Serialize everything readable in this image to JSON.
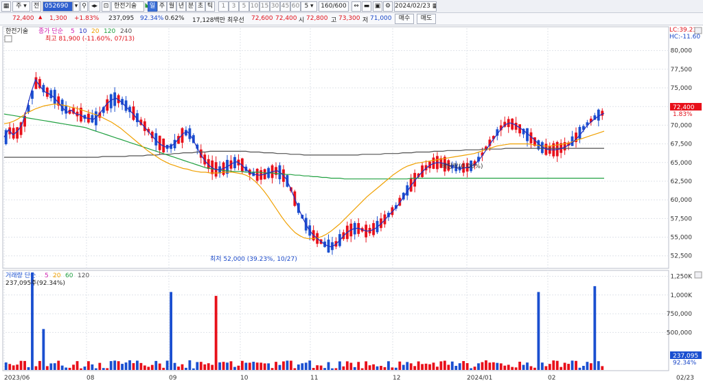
{
  "toolbar": {
    "code": "052690",
    "stock_name": "한전기술",
    "period_buttons": [
      "일",
      "주",
      "월",
      "년",
      "분",
      "초",
      "틱"
    ],
    "period_selected": "일",
    "number_buttons": [
      "1",
      "3",
      "5",
      "10",
      "15",
      "30",
      "45",
      "60"
    ],
    "count_select": "5",
    "bar_count": "160/600",
    "date": "2024/02/23",
    "menu_label": "주",
    "jeon_label": "전"
  },
  "quote": {
    "price": "72,400",
    "change": "1,300",
    "change_pct": "+1.83%",
    "volume": "237,095",
    "volume_ratio": "92.34%",
    "turnover_rate": "0.62%",
    "trade_value": "17,128백만",
    "best_ask_label": "최우선",
    "best_ask": "72,600",
    "best_bid": "72,400",
    "open_label": "시",
    "open": "72,800",
    "high_label": "고",
    "high": "73,300",
    "low_label": "저",
    "low": "71,000",
    "buy_button": "매수",
    "sell_button": "매도"
  },
  "colors": {
    "up": "#e8101a",
    "down": "#1a4fd0",
    "ma5": "#d020b0",
    "ma10": "#2030c0",
    "ma20": "#f0a000",
    "ma60": "#20a040",
    "ma120": "#505050",
    "grid": "#dfe3ea"
  },
  "price_panel": {
    "legend_name": "한전기술",
    "legend_label": "종가 단순",
    "legend_periods": [
      "5",
      "10",
      "20",
      "120",
      "240"
    ],
    "high_annotation": "최고 81,900 (-11.60%, 07/13)",
    "low_annotation": "최저 52,000 (39.23%, 10/27)",
    "event_annotation": "배당락(0.00%)",
    "lc_label": "LC:39.23",
    "hc_label": "HC:-11.60",
    "current_price_tag": "72,400",
    "current_change_tag": "1.83%"
  },
  "volume_panel": {
    "legend_label": "거래량 단순",
    "legend_periods": [
      "5",
      "20",
      "60",
      "120"
    ],
    "summary": "237,095주(92.34%)",
    "current_volume_tag": "237,095",
    "current_ratio_tag": "92.34%"
  },
  "chart_data": {
    "type": "candlestick",
    "price_axis_ticks": [
      "80,000",
      "77,500",
      "75,000",
      "72,500",
      "70,000",
      "67,500",
      "65,000",
      "62,500",
      "60,000",
      "57,500",
      "55,000",
      "52,500"
    ],
    "price_axis_values": [
      80000,
      77500,
      75000,
      72500,
      70000,
      67500,
      65000,
      62500,
      60000,
      57500,
      55000,
      52500
    ],
    "price_range": [
      51000,
      83000
    ],
    "volume_axis_ticks": [
      "1,250K",
      "1,000K",
      "750,000",
      "500,000"
    ],
    "volume_axis_values": [
      1250000,
      1000000,
      750000,
      500000
    ],
    "volume_range": [
      0,
      1300000
    ],
    "x_axis_labels": [
      "2023/06",
      "08",
      "09",
      "10",
      "11",
      "12",
      "2024/01",
      "02",
      "02/23"
    ],
    "x_axis_label_index": [
      0,
      41,
      80,
      117,
      150,
      189,
      227,
      264,
      159
    ],
    "ma5": [
      68400,
      69400,
      68700,
      69200,
      70100,
      72100,
      74300,
      76100,
      75200,
      74500,
      74200,
      73800,
      73100,
      72400,
      71700,
      72000,
      71500,
      71400,
      71000,
      70900,
      70800,
      71300,
      72100,
      72900,
      73400,
      73600,
      73200,
      72600,
      72000,
      71400,
      70600,
      70000,
      69300,
      68600,
      67900,
      67400,
      67100,
      67100,
      67500,
      68200,
      68900,
      69100,
      68300,
      67100,
      66000,
      65100,
      64500,
      64100,
      64000,
      64200,
      64500,
      64900,
      65100,
      64700,
      64100,
      63600,
      63400,
      63300,
      63400,
      63600,
      63800,
      63900,
      63500,
      62800,
      61500,
      60000,
      58500,
      57200,
      56100,
      55300,
      54800,
      54300,
      53900,
      53700,
      54000,
      54600,
      55300,
      55800,
      56100,
      56200,
      56000,
      55800,
      55900,
      56200,
      56700,
      57300,
      58000,
      58600,
      59300,
      60200,
      61100,
      62000,
      62800,
      63500,
      64100,
      64600,
      64900,
      65000,
      64900,
      64700,
      64500,
      64300,
      64200,
      64300,
      64400,
      64700,
      65300,
      66100,
      67000,
      67900,
      68700,
      69500,
      70100,
      70300,
      70100,
      69700,
      69300,
      68800,
      68300,
      67700,
      67200,
      66800,
      66700,
      66700,
      66800,
      67000,
      67300,
      67700,
      68300,
      69000,
      69800,
      70400,
      70900,
      71300,
      71600
    ],
    "ma20": [
      70200,
      70300,
      70500,
      70800,
      71200,
      71600,
      71900,
      72200,
      72400,
      72600,
      72700,
      72800,
      72800,
      72700,
      72600,
      72400,
      72300,
      72100,
      71900,
      71700,
      71500,
      71300,
      71000,
      70700,
      70400,
      70000,
      69600,
      69100,
      68600,
      68100,
      67600,
      67100,
      66600,
      66200,
      65800,
      65400,
      65100,
      64800,
      64600,
      64400,
      64200,
      64100,
      63900,
      63800,
      63700,
      63700,
      63600,
      63600,
      63600,
      63700,
      63700,
      63700,
      63600,
      63500,
      63300,
      63000,
      62500,
      61900,
      61200,
      60400,
      59500,
      58600,
      57700,
      56900,
      56200,
      55600,
      55200,
      54900,
      54800,
      54800,
      54900,
      55100,
      55400,
      55800,
      56300,
      56800,
      57400,
      58000,
      58600,
      59200,
      59800,
      60400,
      60900,
      61400,
      61900,
      62400,
      62900,
      63400,
      63800,
      64200,
      64500,
      64700,
      64900,
      65000,
      65100,
      65200,
      65300,
      65400,
      65500,
      65600,
      65700,
      65800,
      65900,
      66000,
      66100,
      66200,
      66400,
      66600,
      66800,
      67000,
      67200,
      67300,
      67400,
      67500,
      67500,
      67500,
      67500,
      67500,
      67400,
      67300,
      67200,
      67200,
      67200,
      67300,
      67400,
      67500,
      67600,
      67800,
      68000,
      68200,
      68400,
      68600,
      68800,
      69000,
      69200
    ],
    "ma60": [
      71500,
      71400,
      71300,
      71200,
      71100,
      71000,
      70900,
      70800,
      70700,
      70600,
      70500,
      70400,
      70300,
      70200,
      70100,
      70000,
      69900,
      69800,
      69700,
      69500,
      69300,
      69100,
      68900,
      68700,
      68500,
      68300,
      68100,
      67900,
      67700,
      67500,
      67300,
      67100,
      66900,
      66700,
      66500,
      66300,
      66100,
      65900,
      65700,
      65500,
      65300,
      65100,
      64900,
      64700,
      64500,
      64300,
      64200,
      64100,
      64000,
      63900,
      63900,
      63800,
      63800,
      63800,
      63700,
      63700,
      63700,
      63700,
      63600,
      63600,
      63600,
      63500,
      63500,
      63400,
      63400,
      63300,
      63300,
      63200,
      63200,
      63100,
      63100,
      63000,
      63000,
      62900,
      62900,
      62900,
      62800,
      62800,
      62800,
      62800,
      62800,
      62800,
      62800,
      62800,
      62800,
      62800,
      62800,
      62800,
      62800,
      62800,
      62800,
      62900,
      62900,
      62900,
      62900,
      62900,
      62900,
      62900,
      62900,
      62900,
      62900,
      62900,
      62900,
      62900,
      62900,
      62900,
      62900,
      62900,
      62900,
      62900,
      62900,
      62900,
      62900,
      62900,
      62900,
      62900,
      62900,
      62900,
      62900,
      62900,
      62900,
      62900,
      62900,
      62900,
      62900,
      62900,
      62900,
      62900,
      62900,
      62900,
      62900,
      62900,
      62900,
      62900,
      62900
    ],
    "ma120": [
      65700,
      65700,
      65700,
      65700,
      65700,
      65700,
      65700,
      65700,
      65700,
      65700,
      65700,
      65700,
      65700,
      65700,
      65700,
      65700,
      65700,
      65700,
      65700,
      65700,
      65700,
      65700,
      65800,
      65800,
      65800,
      65800,
      65800,
      65800,
      65900,
      65900,
      65900,
      65900,
      66000,
      66000,
      66000,
      66100,
      66100,
      66100,
      66200,
      66200,
      66300,
      66300,
      66300,
      66400,
      66400,
      66400,
      66500,
      66500,
      66500,
      66500,
      66500,
      66500,
      66500,
      66500,
      66500,
      66400,
      66400,
      66400,
      66300,
      66300,
      66300,
      66200,
      66200,
      66200,
      66100,
      66100,
      66100,
      66000,
      66000,
      66000,
      66000,
      66000,
      66000,
      66000,
      66000,
      66000,
      66000,
      66000,
      66000,
      66000,
      66100,
      66100,
      66100,
      66100,
      66100,
      66200,
      66200,
      66200,
      66200,
      66300,
      66300,
      66300,
      66400,
      66400,
      66400,
      66400,
      66500,
      66500,
      66500,
      66600,
      66600,
      66600,
      66600,
      66700,
      66700,
      66700,
      66700,
      66800,
      66800,
      66800,
      66800,
      66800,
      66900,
      66900,
      66900,
      66900,
      66900,
      66900,
      66900,
      66900,
      66900,
      66900,
      66900,
      66900,
      66900,
      66900,
      66900,
      66900,
      66900,
      66900,
      66900,
      66900,
      66900,
      66900,
      66900
    ]
  }
}
